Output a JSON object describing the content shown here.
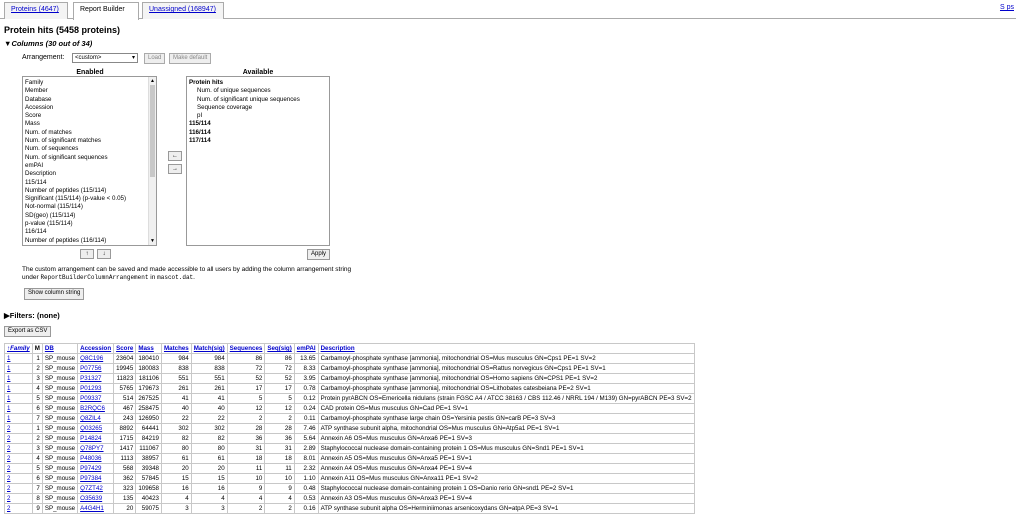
{
  "tabs": [
    {
      "label": "Proteins (4647)",
      "active": false
    },
    {
      "label": "Report Builder",
      "active": true
    },
    {
      "label": "Unassigned (168947)",
      "active": false
    }
  ],
  "tab_right_link": "S ps",
  "page_title": "Protein hits (5458 proteins)",
  "columns_section": {
    "toggle_glyph": "▼",
    "label": "Columns (30 out of 34)",
    "arrangement_label": "Arrangement:",
    "arrangement_value": "<custom>",
    "load_label": "Load",
    "make_default_label": "Make default",
    "enabled_heading": "Enabled",
    "available_heading": "Available",
    "enabled_items": [
      "Family",
      "Member",
      "Database",
      "Accession",
      "Score",
      "Mass",
      "Num. of matches",
      "Num. of significant matches",
      "Num. of sequences",
      "Num. of significant sequences",
      "emPAI",
      "Description",
      "115/114",
      "Number of peptides (115/114)",
      "Significant (115/114) (p-value < 0.05)",
      "Not-normal (115/114)",
      "SD(geo) (115/114)",
      "p-value (115/114)",
      "116/114",
      "Number of peptides (116/114)"
    ],
    "available_items": [
      {
        "text": "Protein hits",
        "bold": true,
        "indent": false
      },
      {
        "text": "Num. of unique sequences",
        "bold": false,
        "indent": true
      },
      {
        "text": "Num. of significant unique sequences",
        "bold": false,
        "indent": true
      },
      {
        "text": "Sequence coverage",
        "bold": false,
        "indent": true
      },
      {
        "text": "pI",
        "bold": false,
        "indent": true
      },
      {
        "text": "115/114",
        "bold": true,
        "indent": false
      },
      {
        "text": "116/114",
        "bold": true,
        "indent": false
      },
      {
        "text": "117/114",
        "bold": true,
        "indent": false
      }
    ],
    "move_left_glyph": "←",
    "move_right_glyph": "→",
    "move_up_glyph": "↑",
    "move_down_glyph": "↓",
    "apply_label": "Apply",
    "note_part1": "The custom arrangement can be saved and made accessible to all users by adding the column arrangement string under ",
    "note_code1": "ReportBuilderColumnArrangement",
    "note_part2": " in ",
    "note_code2": "mascot.dat",
    "note_part3": ".",
    "show_column_string_label": "Show column string"
  },
  "filters": {
    "toggle_glyph": "▶",
    "label": "Filters: (none)"
  },
  "export_label": "Export as CSV",
  "table": {
    "headers": [
      "↑Family",
      "M",
      "DB",
      "Accession",
      "Score",
      "Mass",
      "Matches",
      "Match(sig)",
      "Sequences",
      "Seq(sig)",
      "emPAI",
      "Description"
    ],
    "rows": [
      [
        "1",
        "1",
        "SP_mouse",
        "Q8C196",
        "23604",
        "180410",
        "984",
        "984",
        "86",
        "86",
        "13.65",
        "Carbamoyl-phosphate synthase [ammonia], mitochondrial OS=Mus musculus GN=Cps1 PE=1 SV=2"
      ],
      [
        "1",
        "2",
        "SP_mouse",
        "P07756",
        "19945",
        "180083",
        "838",
        "838",
        "72",
        "72",
        "8.33",
        "Carbamoyl-phosphate synthase [ammonia], mitochondrial OS=Rattus norvegicus GN=Cps1 PE=1 SV=1"
      ],
      [
        "1",
        "3",
        "SP_mouse",
        "P31327",
        "11823",
        "181106",
        "551",
        "551",
        "52",
        "52",
        "3.95",
        "Carbamoyl-phosphate synthase [ammonia], mitochondrial OS=Homo sapiens GN=CPS1 PE=1 SV=2"
      ],
      [
        "1",
        "4",
        "SP_mouse",
        "P01293",
        "5765",
        "179673",
        "261",
        "261",
        "17",
        "17",
        "0.78",
        "Carbamoyl-phosphate synthase [ammonia], mitochondrial OS=Lithobates catesbeiana PE=2 SV=1"
      ],
      [
        "1",
        "5",
        "SP_mouse",
        "P09337",
        "514",
        "267525",
        "41",
        "41",
        "5",
        "5",
        "0.12",
        "Protein pyrABCN OS=Emericella nidulans (strain FGSC A4 / ATCC 38163 / CBS 112.46 / NRRL 194 / M139) GN=pyrABCN PE=3 SV=2"
      ],
      [
        "1",
        "6",
        "SP_mouse",
        "B2RQC6",
        "467",
        "258475",
        "40",
        "40",
        "12",
        "12",
        "0.24",
        "CAD protein OS=Mus musculus GN=Cad PE=1 SV=1"
      ],
      [
        "1",
        "7",
        "SP_mouse",
        "Q8ZIL4",
        "243",
        "126950",
        "22",
        "22",
        "2",
        "2",
        "0.11",
        "Carbamoyl-phosphate synthase large chain OS=Yersinia pestis GN=carB PE=3 SV=3"
      ],
      [
        "2",
        "1",
        "SP_mouse",
        "Q03265",
        "8892",
        "64441",
        "302",
        "302",
        "28",
        "28",
        "7.46",
        "ATP synthase subunit alpha, mitochondrial OS=Mus musculus GN=Atp5a1 PE=1 SV=1"
      ],
      [
        "2",
        "2",
        "SP_mouse",
        "P14824",
        "1715",
        "84219",
        "82",
        "82",
        "36",
        "36",
        "5.64",
        "Annexin A6 OS=Mus musculus GN=Anxa6 PE=1 SV=3"
      ],
      [
        "2",
        "3",
        "SP_mouse",
        "Q78PY7",
        "1417",
        "111067",
        "80",
        "80",
        "31",
        "31",
        "2.89",
        "Staphylococcal nuclease domain-containing protein 1 OS=Mus musculus GN=Snd1 PE=1 SV=1"
      ],
      [
        "2",
        "4",
        "SP_mouse",
        "P48036",
        "1113",
        "38957",
        "61",
        "61",
        "18",
        "18",
        "8.01",
        "Annexin A5 OS=Mus musculus GN=Anxa5 PE=1 SV=1"
      ],
      [
        "2",
        "5",
        "SP_mouse",
        "P97429",
        "568",
        "39348",
        "20",
        "20",
        "11",
        "11",
        "2.32",
        "Annexin A4 OS=Mus musculus GN=Anxa4 PE=1 SV=4"
      ],
      [
        "2",
        "6",
        "SP_mouse",
        "P97384",
        "362",
        "57845",
        "15",
        "15",
        "10",
        "10",
        "1.10",
        "Annexin A11 OS=Mus musculus GN=Anxa11 PE=1 SV=2"
      ],
      [
        "2",
        "7",
        "SP_mouse",
        "Q7ZT42",
        "323",
        "109658",
        "16",
        "16",
        "9",
        "9",
        "0.48",
        "Staphylococcal nuclease domain-containing protein 1 OS=Danio rerio GN=snd1 PE=2 SV=1"
      ],
      [
        "2",
        "8",
        "SP_mouse",
        "O35639",
        "135",
        "40423",
        "4",
        "4",
        "4",
        "4",
        "0.53",
        "Annexin A3 OS=Mus musculus GN=Anxa3 PE=1 SV=4"
      ],
      [
        "2",
        "9",
        "SP_mouse",
        "A4G4H1",
        "20",
        "59075",
        "3",
        "3",
        "2",
        "2",
        "0.16",
        "ATP synthase subunit alpha OS=Herminiimonas arsenicoxydans GN=atpA PE=3 SV=1"
      ]
    ]
  }
}
